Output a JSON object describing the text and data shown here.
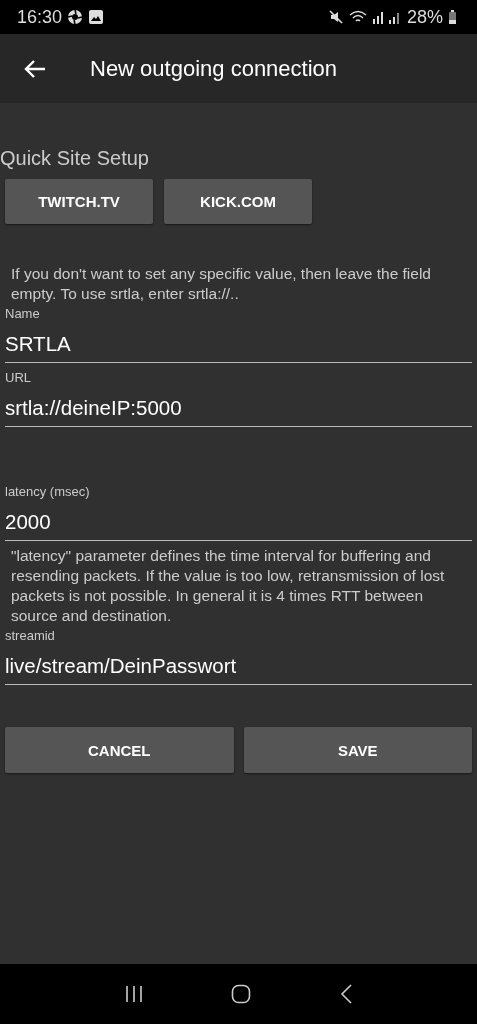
{
  "status_bar": {
    "time": "16:30",
    "battery": "28%"
  },
  "app_bar": {
    "title": "New outgoing connection"
  },
  "quick_setup": {
    "title": "Quick Site Setup",
    "buttons": [
      "TWITCH.TV",
      "KICK.COM"
    ]
  },
  "hint": "If you don't want to set any specific value, then leave the field empty. To use srtla, enter srtla://..",
  "sections": [
    {
      "fields": [
        {
          "label": "Name",
          "value": "SRTLA"
        },
        {
          "label": "URL",
          "value": "srtla://deineIP:5000"
        }
      ]
    },
    {
      "fields": [
        {
          "label": "latency (msec)",
          "value": "2000",
          "note": "\"latency\" parameter defines the time interval for buffering and resending packets. If the value is too low, retransmission of lost packets is not possible. In general it is 4 times RTT between source and destination."
        },
        {
          "label": "streamid",
          "value": "live/stream/DeinPasswort"
        }
      ]
    }
  ],
  "actions": [
    "CANCEL",
    "SAVE"
  ]
}
